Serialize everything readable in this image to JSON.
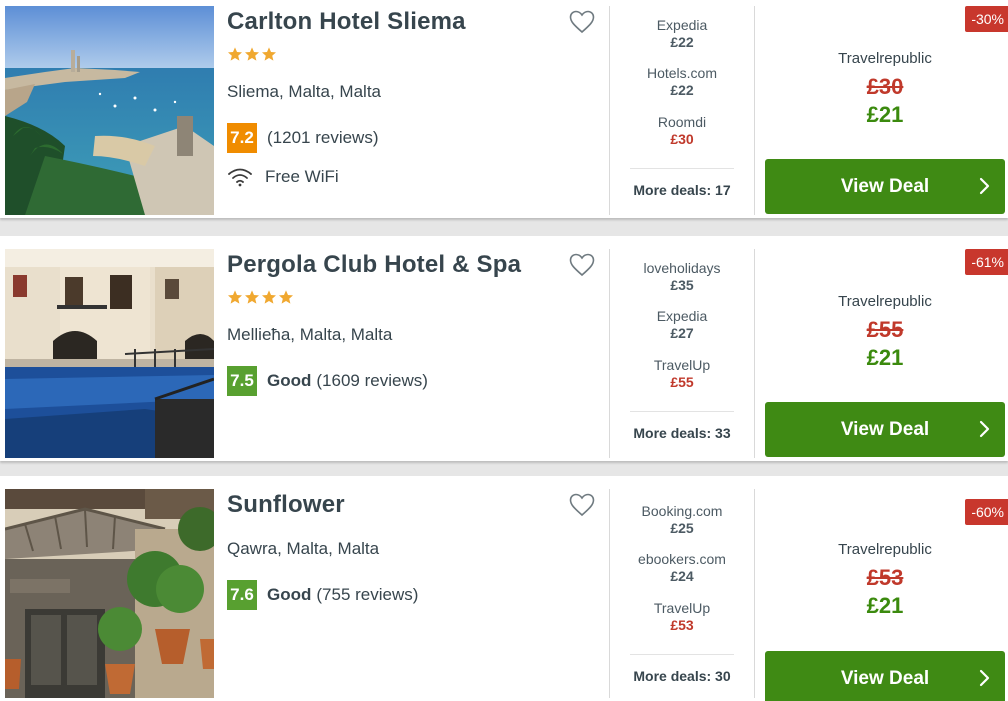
{
  "hotels": [
    {
      "name": "Carlton Hotel Sliema",
      "stars": 3,
      "location": "Sliema, Malta, Malta",
      "rating": {
        "score": "7.2",
        "word": "",
        "reviews": "(1201 reviews)",
        "color": "#f08c00"
      },
      "amenity": {
        "icon": "wifi-icon",
        "label": "Free WiFi"
      },
      "deals": [
        {
          "site": "Expedia",
          "price": "£22",
          "highlight": false
        },
        {
          "site": "Hotels.com",
          "price": "£22",
          "highlight": false
        },
        {
          "site": "Roomdi",
          "price": "£30",
          "highlight": true
        }
      ],
      "more_deals": "More deals: 17",
      "offer": {
        "discount": "-30%",
        "site": "Travelrepublic",
        "old_price": "£30",
        "new_price": "£21",
        "button": "View Deal"
      }
    },
    {
      "name": "Pergola Club Hotel & Spa",
      "stars": 4,
      "location": "Mellieħa, Malta, Malta",
      "rating": {
        "score": "7.5",
        "word": "Good",
        "reviews": "(1609 reviews)",
        "color": "#58a030"
      },
      "deals": [
        {
          "site": "loveholidays",
          "price": "£35",
          "highlight": false
        },
        {
          "site": "Expedia",
          "price": "£27",
          "highlight": false
        },
        {
          "site": "TravelUp",
          "price": "£55",
          "highlight": true
        }
      ],
      "more_deals": "More deals: 33",
      "offer": {
        "discount": "-61%",
        "site": "Travelrepublic",
        "old_price": "£55",
        "new_price": "£21",
        "button": "View Deal"
      }
    },
    {
      "name": "Sunflower",
      "stars": 0,
      "location": "Qawra, Malta, Malta",
      "rating": {
        "score": "7.6",
        "word": "Good",
        "reviews": "(755 reviews)",
        "color": "#58a030"
      },
      "deals": [
        {
          "site": "Booking.com",
          "price": "£25",
          "highlight": false
        },
        {
          "site": "ebookers.com",
          "price": "£24",
          "highlight": false
        },
        {
          "site": "TravelUp",
          "price": "£53",
          "highlight": true
        }
      ],
      "more_deals": "More deals: 30",
      "offer": {
        "discount": "-60%",
        "site": "Travelrepublic",
        "old_price": "£53",
        "new_price": "£21",
        "button": "View Deal"
      }
    }
  ],
  "icons": {
    "favorite": "heart-icon",
    "star": "star-icon",
    "chevron": "chevron-right-icon"
  },
  "colors": {
    "accent_green": "#3f8a14",
    "price_green": "#3b8a0e",
    "price_red": "#c0392b",
    "badge_red": "#c8372d",
    "star_gold": "#f0a830"
  }
}
